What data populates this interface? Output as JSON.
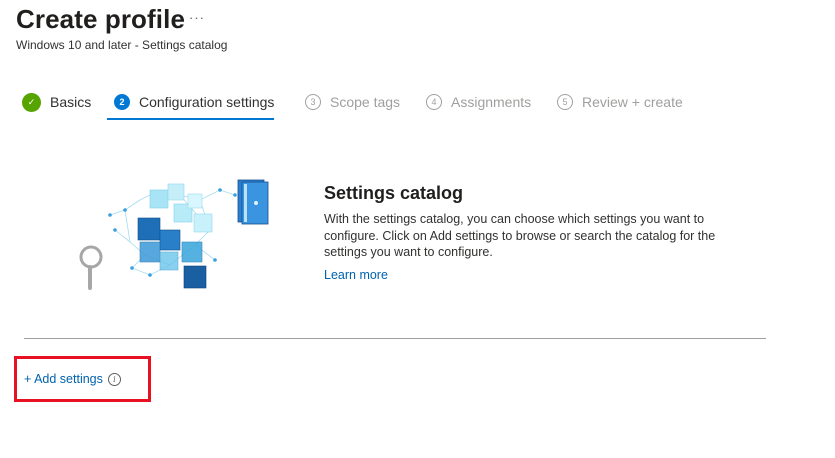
{
  "header": {
    "title": "Create profile",
    "more_label": "···",
    "subtitle": "Windows 10 and later - Settings catalog"
  },
  "wizard": {
    "steps": [
      {
        "number": "✓",
        "label": "Basics",
        "state": "completed"
      },
      {
        "number": "2",
        "label": "Configuration settings",
        "state": "current"
      },
      {
        "number": "3",
        "label": "Scope tags",
        "state": "pending"
      },
      {
        "number": "4",
        "label": "Assignments",
        "state": "pending"
      },
      {
        "number": "5",
        "label": "Review + create",
        "state": "pending"
      }
    ]
  },
  "catalog_info": {
    "title": "Settings catalog",
    "description": "With the settings catalog, you can choose which settings you want to configure. Click on Add settings to browse or search the catalog for the settings you want to configure.",
    "learn_more": "Learn more"
  },
  "actions": {
    "add_settings": "+ Add settings",
    "info_glyph": "i"
  },
  "colors": {
    "accent": "#0078d4",
    "link": "#0062ad",
    "success": "#57a300",
    "highlight": "#e81123"
  }
}
